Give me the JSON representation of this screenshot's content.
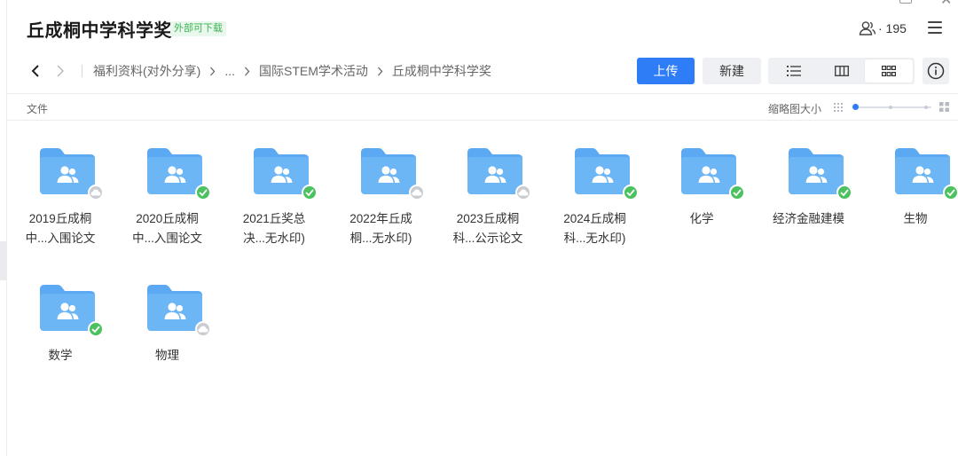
{
  "header": {
    "title": "丘成桐中学科学奖",
    "badge": "外部可下载",
    "member_count": "· 195"
  },
  "breadcrumb": {
    "items": [
      "福利资料(对外分享)",
      "...",
      "国际STEM学术活动",
      "丘成桐中学科学奖"
    ]
  },
  "toolbar": {
    "upload_label": "上传",
    "new_label": "新建",
    "view_modes": [
      "list-view-icon",
      "column-view-icon",
      "grid-view-icon"
    ],
    "active_view": "grid"
  },
  "content": {
    "files_label": "文件",
    "thumb_size_label": "缩略图大小",
    "folders": [
      {
        "line1": "2019丘成桐",
        "line2": "中...入围论文",
        "status": "cloud"
      },
      {
        "line1": "2020丘成桐",
        "line2": "中...入围论文",
        "status": "synced"
      },
      {
        "line1": "2021丘奖总",
        "line2": "决...无水印)",
        "status": "synced"
      },
      {
        "line1": "2022年丘成",
        "line2": "桐...无水印)",
        "status": "cloud"
      },
      {
        "line1": "2023丘成桐",
        "line2": "科...公示论文",
        "status": "cloud"
      },
      {
        "line1": "2024丘成桐",
        "line2": "科...无水印)",
        "status": "synced"
      },
      {
        "line1": "化学",
        "line2": "",
        "status": "synced"
      },
      {
        "line1": "经济金融建模",
        "line2": "",
        "status": "synced"
      },
      {
        "line1": "生物",
        "line2": "",
        "status": "synced"
      },
      {
        "line1": "数学",
        "line2": "",
        "status": "synced"
      },
      {
        "line1": "物理",
        "line2": "",
        "status": "cloud"
      }
    ]
  },
  "colors": {
    "accent": "#2e7cf6",
    "folder": "#5aa9f2",
    "synced": "#4cc15f",
    "cloud": "#c9ccd1"
  }
}
